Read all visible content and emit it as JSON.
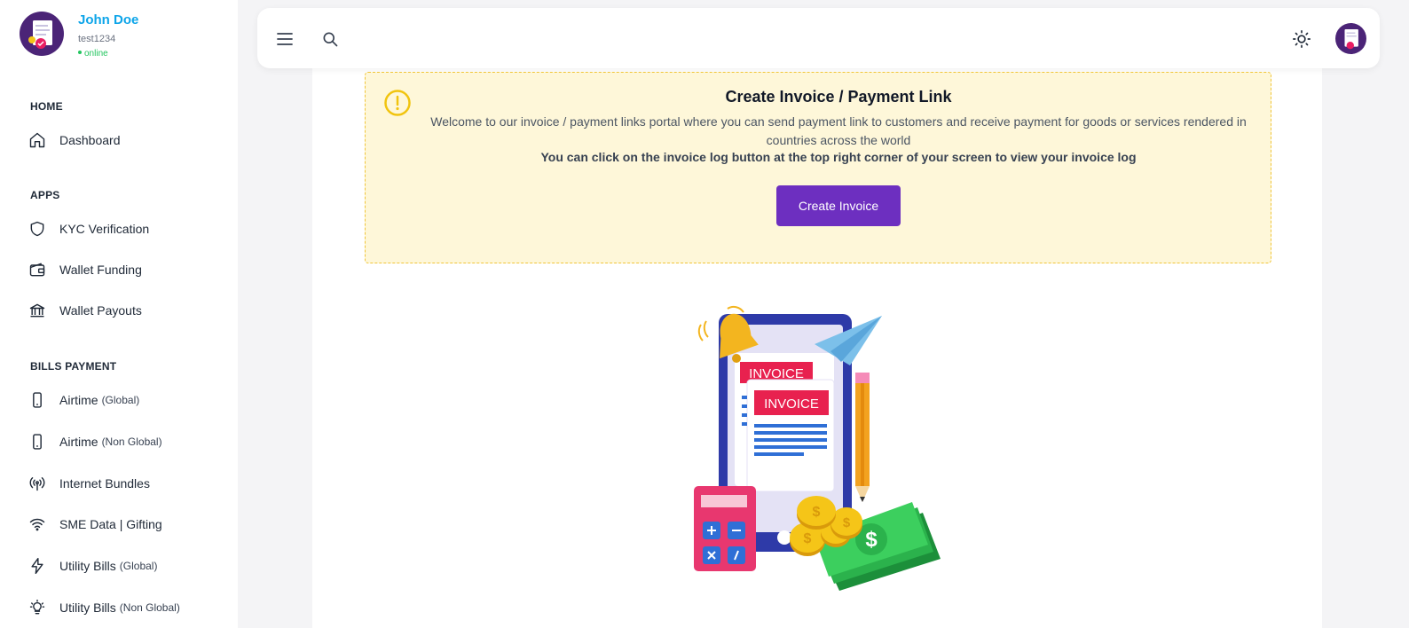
{
  "user": {
    "name": "John Doe",
    "username": "test1234",
    "status": "online"
  },
  "sidebar": {
    "sections": [
      {
        "title": "HOME",
        "items": [
          {
            "label": "Dashboard",
            "icon": "home-icon"
          }
        ]
      },
      {
        "title": "APPS",
        "items": [
          {
            "label": "KYC Verification",
            "icon": "shield-icon"
          },
          {
            "label": "Wallet Funding",
            "icon": "wallet-icon"
          },
          {
            "label": "Wallet Payouts",
            "icon": "bank-icon"
          }
        ]
      },
      {
        "title": "BILLS PAYMENT",
        "items": [
          {
            "label": "Airtime",
            "sub": "(Global)",
            "icon": "phone-icon"
          },
          {
            "label": "Airtime",
            "sub": "(Non Global)",
            "icon": "phone-icon"
          },
          {
            "label": "Internet Bundles",
            "icon": "antenna-icon"
          },
          {
            "label": "SME Data | Gifting",
            "icon": "wifi-icon"
          },
          {
            "label": "Utility Bills",
            "sub": "(Global)",
            "icon": "bolt-icon"
          },
          {
            "label": "Utility Bills",
            "sub": "(Non Global)",
            "icon": "bulb-icon"
          }
        ]
      }
    ]
  },
  "topbar": {
    "menu_icon": "hamburger-icon",
    "search_icon": "search-icon",
    "theme_icon": "sun-icon"
  },
  "alert": {
    "title": "Create Invoice / Payment Link",
    "text": "Welcome to our invoice / payment links portal where you can send payment link to customers and receive payment for goods or services rendered in countries across the world",
    "bold_text": "You can click on the invoice log button at the top right corner of your screen to view your invoice log",
    "button_label": "Create Invoice"
  },
  "illustration": {
    "label_1": "INVOICE",
    "label_2": "INVOICE"
  },
  "colors": {
    "primary": "#6d2fc0",
    "accent": "#0ea5e9",
    "online": "#22c55e",
    "alert_bg": "#fef7d9"
  }
}
